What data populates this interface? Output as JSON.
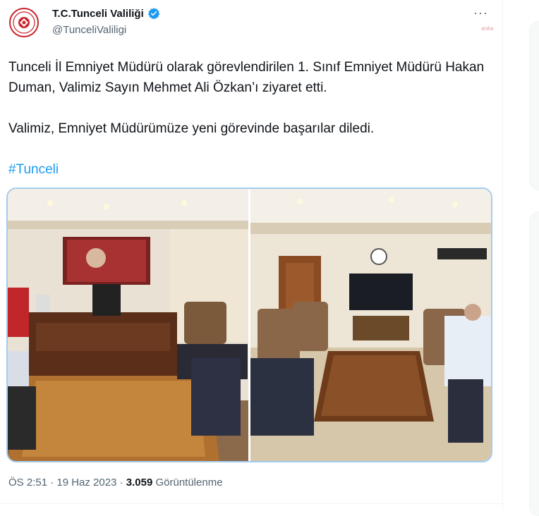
{
  "tweet": {
    "display_name": "T.C.Tunceli Valiliği",
    "handle": "@TunceliValiligi",
    "verified_icon": "verified-badge-icon",
    "more_label": "···",
    "watermark": "anka",
    "paragraph1": "Tunceli İl Emniyet Müdürü olarak görevlendirilen 1. Sınıf Emniyet Müdürü Hakan Duman, Valimiz Sayın Mehmet Ali Özkan’ı ziyaret etti.",
    "paragraph2": "Valimiz, Emniyet Müdürümüze yeni görevinde başarılar diledi.",
    "hashtag": "#Tunceli",
    "time": "ÖS 2:51 · 19 Haz 2023 · ",
    "views_count": "3.059",
    "views_label": " Görüntülenme"
  },
  "colors": {
    "accent": "#1d9bf0",
    "text": "#0f1419",
    "muted": "#536471",
    "media_border": "#a3ccf0"
  }
}
